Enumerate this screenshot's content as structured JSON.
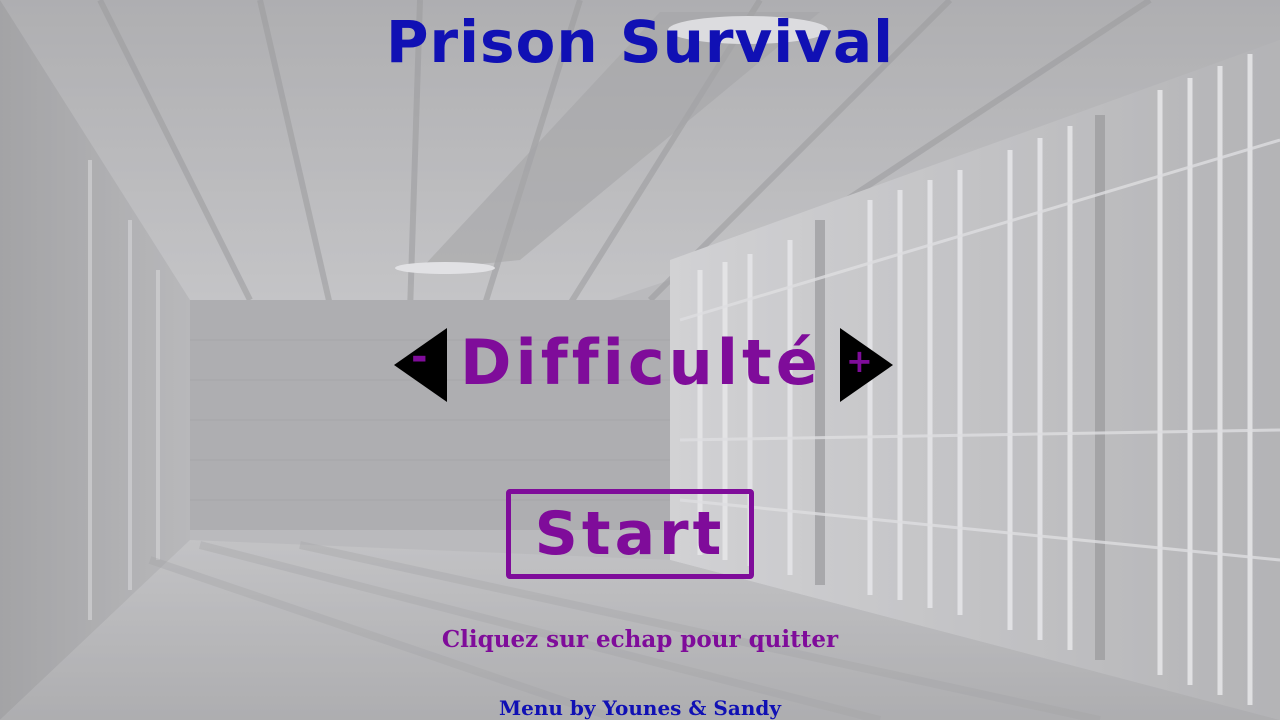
{
  "title": "Prison Survival",
  "difficulty": {
    "label": "Difficulté",
    "decrease_symbol": "-",
    "increase_symbol": "+"
  },
  "start_button": {
    "label": "Start"
  },
  "quit_hint": "Cliquez sur echap pour quitter",
  "credits": "Menu by Younes & Sandy",
  "colors": {
    "title": "#1010b4",
    "accent": "#7f0c9a",
    "arrow": "#000000"
  },
  "background": {
    "scene": "prison-corridor"
  }
}
